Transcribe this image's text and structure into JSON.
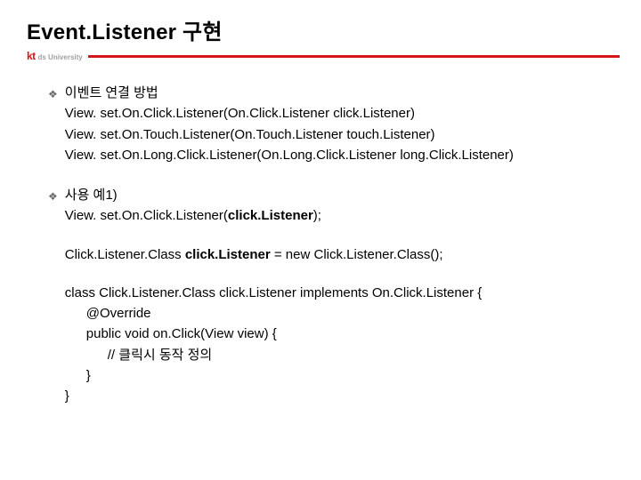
{
  "header": {
    "title": "Event.Listener 구현",
    "logo": {
      "kt": "kt",
      "ds": "ds University"
    }
  },
  "content": {
    "bullets": [
      {
        "heading": "이벤트 연결 방법",
        "lines": [
          "View. set.On.Click.Listener(On.Click.Listener click.Listener)",
          "View. set.On.Touch.Listener(On.Touch.Listener touch.Listener)",
          "View. set.On.Long.Click.Listener(On.Long.Click.Listener long.Click.Listener)"
        ]
      },
      {
        "heading": "사용 예1)",
        "ex1": {
          "pre": "View. set.On.Click.Listener(",
          "bold": "click.Listener",
          "post": ");"
        },
        "ex2": {
          "pre": "Click.Listener.Class ",
          "bold": "click.Listener",
          "post": " = new Click.Listener.Class();"
        },
        "classBlock": {
          "decl": "class Click.Listener.Class click.Listener implements On.Click.Listener {",
          "body": [
            "@Override",
            "public void on.Click(View view) {",
            "// 클릭시 동작 정의",
            "}"
          ],
          "close": "}"
        }
      }
    ]
  }
}
